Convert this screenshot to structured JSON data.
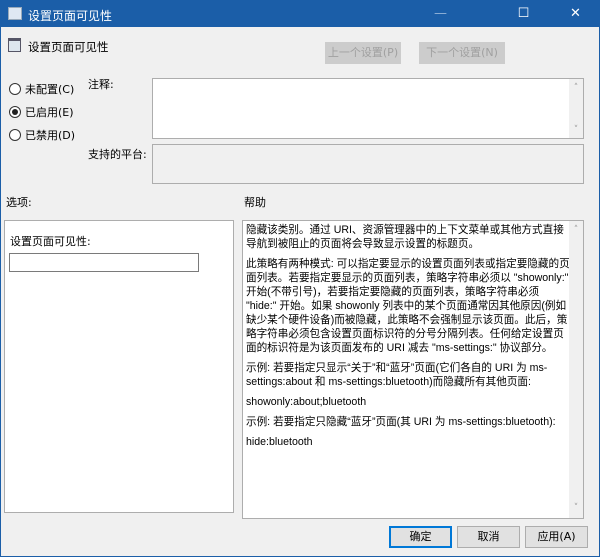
{
  "window": {
    "title": "设置页面可见性",
    "minimize": "—",
    "maximize": "☐",
    "close": "✕"
  },
  "header": {
    "policy_name": "设置页面可见性",
    "prev_button": "上一个设置(P)",
    "next_button": "下一个设置(N)"
  },
  "state": {
    "options": [
      {
        "label": "未配置(C)",
        "selected": false
      },
      {
        "label": "已启用(E)",
        "selected": true
      },
      {
        "label": "已禁用(D)",
        "selected": false
      }
    ]
  },
  "comment": {
    "label": "注释:",
    "value": ""
  },
  "platform": {
    "label": "支持的平台:",
    "value": ""
  },
  "options_panel": {
    "heading": "选项:",
    "field_label": "设置页面可见性:",
    "field_value": ""
  },
  "help_panel": {
    "heading": "帮助",
    "paragraphs": [
      "隐藏该类别。通过 URI、资源管理器中的上下文菜单或其他方式直接导航到被阻止的页面将会导致显示设置的标题页。",
      "此策略有两种模式: 可以指定要显示的设置页面列表或指定要隐藏的页面列表。若要指定要显示的页面列表，策略字符串必须以 \"showonly:\" 开始(不带引号)，若要指定要隐藏的页面列表，策略字符串必须 \"hide:\" 开始。如果 showonly 列表中的某个页面通常因其他原因(例如缺少某个硬件设备)而被隐藏，此策略不会强制显示该页面。此后，策略字符串必须包含设置页面标识符的分号分隔列表。任何给定设置页面的标识符是为该页面发布的 URI 减去 \"ms-settings:\" 协议部分。",
      "示例: 若要指定只显示“关于”和“蓝牙”页面(它们各自的 URI 为 ms-settings:about 和 ms-settings:bluetooth)而隐藏所有其他页面:",
      "showonly:about;bluetooth",
      "示例: 若要指定只隐藏“蓝牙”页面(其 URI 为 ms-settings:bluetooth):",
      "hide:bluetooth"
    ]
  },
  "footer": {
    "ok": "确定",
    "cancel": "取消",
    "apply": "应用(A)"
  }
}
